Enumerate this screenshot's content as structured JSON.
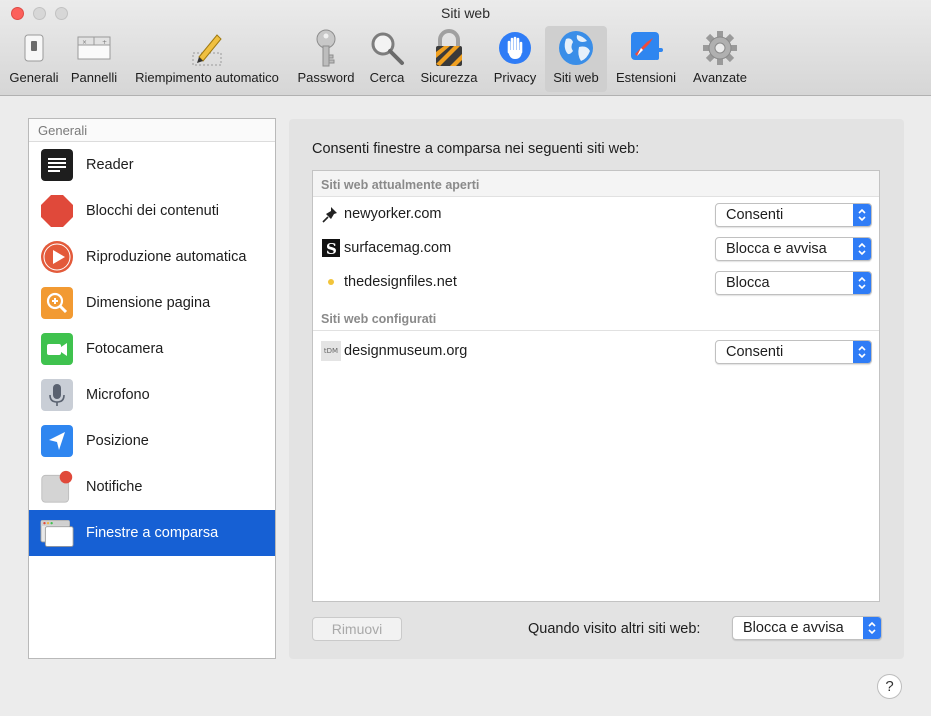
{
  "window": {
    "title": "Siti web"
  },
  "toolbar": {
    "items": [
      {
        "label": "Generali",
        "icon": "switch-icon"
      },
      {
        "label": "Pannelli",
        "icon": "tabs-icon"
      },
      {
        "label": "Riempimento automatico",
        "icon": "pencil-icon"
      },
      {
        "label": "Password",
        "icon": "key-icon"
      },
      {
        "label": "Cerca",
        "icon": "magnifier-icon"
      },
      {
        "label": "Sicurezza",
        "icon": "lock-icon"
      },
      {
        "label": "Privacy",
        "icon": "hand-icon"
      },
      {
        "label": "Siti web",
        "icon": "globe-icon",
        "active": true
      },
      {
        "label": "Estensioni",
        "icon": "compass-icon"
      },
      {
        "label": "Avanzate",
        "icon": "gear-icon"
      }
    ]
  },
  "sidebar": {
    "header": "Generali",
    "items": [
      {
        "label": "Reader",
        "icon": "reader-icon"
      },
      {
        "label": "Blocchi dei contenuti",
        "icon": "stop-sign-icon"
      },
      {
        "label": "Riproduzione automatica",
        "icon": "play-icon"
      },
      {
        "label": "Dimensione pagina",
        "icon": "zoom-icon"
      },
      {
        "label": "Fotocamera",
        "icon": "camera-icon"
      },
      {
        "label": "Microfono",
        "icon": "microphone-icon"
      },
      {
        "label": "Posizione",
        "icon": "location-icon"
      },
      {
        "label": "Notifiche",
        "icon": "notification-icon"
      },
      {
        "label": "Finestre a comparsa",
        "icon": "popup-window-icon",
        "selected": true
      }
    ]
  },
  "main": {
    "title": "Consenti finestre a comparsa nei seguenti siti web:",
    "open_header": "Siti web attualmente aperti",
    "configured_header": "Siti web configurati",
    "open_sites": [
      {
        "site": "newyorker.com",
        "setting": "Consenti",
        "favicon": "pushpin-icon"
      },
      {
        "site": "surfacemag.com",
        "setting": "Blocca e avvisa",
        "favicon": "s-logo-icon"
      },
      {
        "site": "thedesignfiles.net",
        "setting": "Blocca",
        "favicon": "dot-icon"
      }
    ],
    "configured_sites": [
      {
        "site": "designmuseum.org",
        "setting": "Consenti",
        "favicon": "dm-logo-icon",
        "favicon_text": "tDM"
      }
    ],
    "remove_label": "Rimuovi",
    "other_sites_label": "Quando visito altri siti web:",
    "other_sites_value": "Blocca e avvisa",
    "help_label": "?"
  },
  "colors": {
    "accent": "#2f7cf6",
    "selection": "#1660d4"
  }
}
